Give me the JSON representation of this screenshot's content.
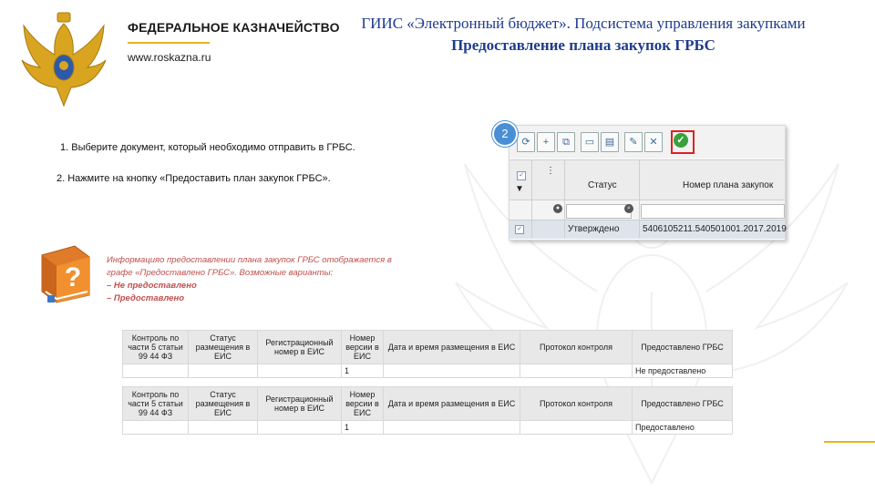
{
  "header": {
    "org_name": "ФЕДЕРАЛЬНОЕ КАЗНАЧЕЙСТВО",
    "org_site": "www.roskazna.ru",
    "title_line1": "ГИИС «Электронный бюджет». Подсистема управления закупками",
    "title_line2": "Предоставление плана закупок ГРБС"
  },
  "colors": {
    "title": "#1e3c8c",
    "accent": "#e6b422",
    "info_text": "#c0504d",
    "badge": "#4a8fd6",
    "highlight": "#e02020"
  },
  "steps": {
    "step1": "1. Выберите документ, который необходимо отправить в ГРБС.",
    "step2": "2. Нажмите на кнопку «Предоставить план закупок ГРБС»."
  },
  "badge": "2",
  "grid": {
    "toolbar_icons": [
      "refresh-icon",
      "add-doc-icon",
      "copy-doc-icon",
      "print-icon",
      "print-alt-icon",
      "edit-icon",
      "delete-icon",
      "export-icon",
      "submit-plan-icon"
    ],
    "columns": {
      "status": "Статус",
      "plan_number": "Номер плана закупок"
    },
    "row": {
      "status": "Утверждено",
      "plan_number": "5406105211.540501001.2017.2019"
    }
  },
  "info": {
    "line1": "Информацияо предоставлении плана закупок ГРБС отображается в",
    "line2": "графе «Предоставлено ГРБС». Возможные варианты:",
    "option1": "–  Не предоставлено",
    "option2": "–  Предоставлено"
  },
  "tables": {
    "headers": [
      "Контроль по части 5 статьи 99 44 ФЗ",
      "Статус размещения в ЕИС",
      "Регистрационный номер в ЕИС",
      "Номер версии в ЕИС",
      "Дата и время размещения в ЕИС",
      "Протокол контроля",
      "Предоставлено ГРБС"
    ],
    "table1_row": [
      "",
      "",
      "",
      "1",
      "",
      "",
      "Не предоставлено"
    ],
    "table2_row": [
      "",
      "",
      "",
      "1",
      "",
      "",
      "Предоставлено"
    ]
  }
}
